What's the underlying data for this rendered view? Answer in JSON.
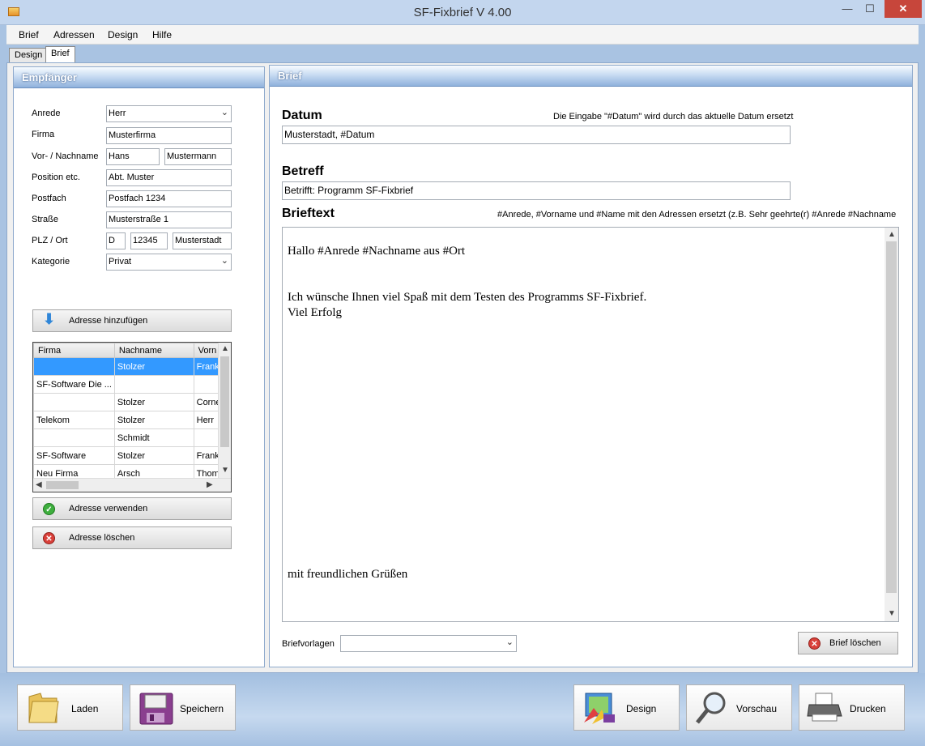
{
  "window": {
    "title": "SF-Fixbrief  V 4.00",
    "minimize": "—",
    "maximize": "☐",
    "close": "✕"
  },
  "menu": [
    "Brief",
    "Adressen",
    "Design",
    "Hilfe"
  ],
  "tabs": [
    "Design",
    "Brief"
  ],
  "empfaenger": {
    "heading": "Empfänger",
    "labels": {
      "anrede": "Anrede",
      "firma": "Firma",
      "name": "Vor- / Nachname",
      "position": "Position etc.",
      "postfach": "Postfach",
      "strasse": "Straße",
      "plzort": "PLZ / Ort",
      "kategorie": "Kategorie"
    },
    "values": {
      "anrede": "Herr",
      "firma": "Musterfirma",
      "vorname": "Hans",
      "nachname": "Mustermann",
      "position": "Abt. Muster",
      "postfach": "Postfach 1234",
      "strasse": "Musterstraße 1",
      "land": "D",
      "plz": "12345",
      "ort": "Musterstadt",
      "kategorie": "Privat"
    },
    "add_button": "Adresse hinzufügen",
    "use_button": "Adresse verwenden",
    "delete_button": "Adresse löschen",
    "grid": {
      "columns": [
        "Firma",
        "Nachname",
        "Vorn"
      ],
      "rows": [
        [
          "",
          "Stolzer",
          "Frank"
        ],
        [
          "SF-Software Die ...",
          "",
          ""
        ],
        [
          "",
          "Stolzer",
          "Corne"
        ],
        [
          "Telekom",
          "Stolzer",
          "Herr"
        ],
        [
          "",
          "Schmidt",
          ""
        ],
        [
          "SF-Software",
          "Stolzer",
          "Frank"
        ],
        [
          "Neu Firma",
          "Arsch",
          "Thom"
        ]
      ]
    }
  },
  "brief": {
    "heading": "Brief",
    "datum_title": "Datum",
    "datum_hint": "Die Eingabe \"#Datum\" wird durch das aktuelle Datum ersetzt",
    "datum_value": "Musterstadt, #Datum",
    "betreff_title": "Betreff",
    "betreff_value": "Betrifft: Programm SF-Fixbrief",
    "text_title": "Brieftext",
    "text_hint": "#Anrede, #Vorname und #Name mit den Adressen ersetzt (z.B. Sehr geehrte(r) #Anrede #Nachname",
    "text_lines": [
      "Hallo #Anrede #Nachname aus #Ort",
      "Ich wünsche Ihnen viel Spaß mit dem Testen des Programms SF-Fixbrief.",
      "Viel Erfolg",
      "mit freundlichen Grüßen"
    ],
    "vorlagen_label": "Briefvorlagen",
    "vorlagen_value": "",
    "delete_button": "Brief löschen"
  },
  "bottom": {
    "laden": "Laden",
    "speichern": "Speichern",
    "design": "Design",
    "vorschau": "Vorschau",
    "drucken": "Drucken"
  },
  "glyphs": {
    "dropdown": "⌄",
    "arrow_up": "▲",
    "arrow_down": "▼",
    "arrow_left": "◀",
    "arrow_right": "▶",
    "check": "✓",
    "cross": "✕",
    "down_arrow": "⬇"
  }
}
